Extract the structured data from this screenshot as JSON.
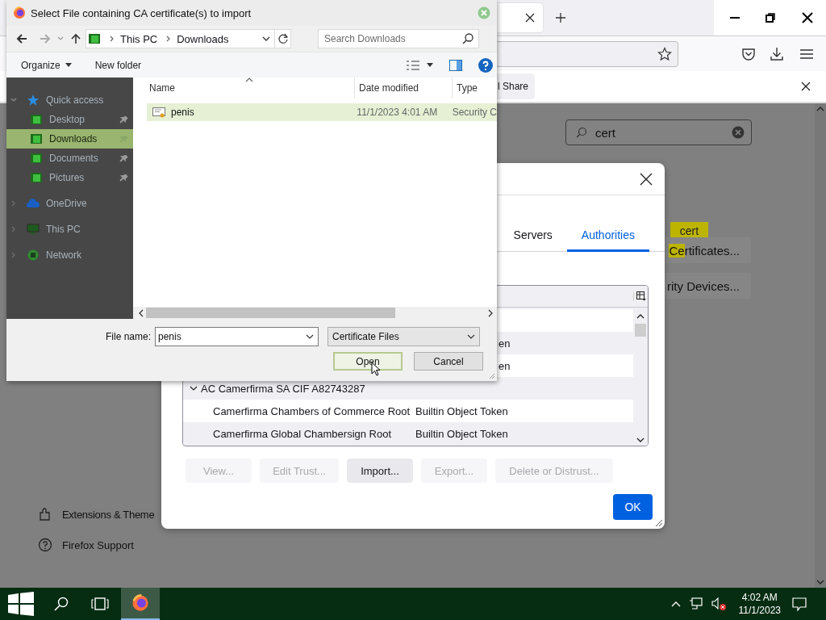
{
  "browser": {
    "notification": {
      "button": "l Share"
    },
    "search": {
      "value": "cert"
    },
    "tooltip": "cert",
    "setting_buttons": [
      {
        "highlighted": "Ce",
        "label": "rtificates..."
      },
      {
        "label": "rity Devices..."
      }
    ],
    "sidebar": [
      {
        "kind": "puzzle",
        "label": "Extensions & Theme"
      },
      {
        "kind": "help",
        "label": "Firefox Support"
      }
    ]
  },
  "cert_dialog": {
    "tabs": [
      {
        "label": "Servers",
        "selected": false
      },
      {
        "label": "Authorities",
        "selected": true
      }
    ],
    "rows": [
      {
        "kind": "blank"
      },
      {
        "kind": "tail",
        "column_2": "en"
      },
      {
        "kind": "tail",
        "column_2": "en"
      },
      {
        "kind": "group",
        "name": "AC Camerfirma SA CIF A82743287",
        "expanded": true,
        "children": [
          {
            "name": "Camerfirma Chambers of Commerce Root",
            "device": "Builtin Object Token"
          },
          {
            "name": "Camerfirma Global Chambersign Root",
            "device": "Builtin Object Token"
          }
        ]
      }
    ],
    "buttons": [
      {
        "label": "View...",
        "disabled": true
      },
      {
        "label": "Edit Trust...",
        "disabled": true
      },
      {
        "label": "Import...",
        "disabled": false
      },
      {
        "label": "Export...",
        "disabled": true
      },
      {
        "label": "Delete or Distrust...",
        "disabled": true
      }
    ],
    "ok": "OK"
  },
  "file_dialog": {
    "title": "Select File containing CA certificate(s) to import",
    "path": [
      "This PC",
      "Downloads"
    ],
    "search_placeholder": "Search Downloads",
    "organize": "Organize",
    "new_folder": "New folder",
    "nav": [
      {
        "label": "Quick access",
        "kind": "star",
        "expanded": true,
        "selected": false,
        "children": [
          {
            "label": "Desktop",
            "pinned": true,
            "selected": false
          },
          {
            "label": "Downloads",
            "pinned": true,
            "selected": true
          },
          {
            "label": "Documents",
            "pinned": true,
            "selected": false
          },
          {
            "label": "Pictures",
            "pinned": true,
            "selected": false
          }
        ]
      },
      {
        "label": "OneDrive",
        "kind": "cloud",
        "expanded": false,
        "selected": false
      },
      {
        "label": "This PC",
        "kind": "pc",
        "expanded": false,
        "selected": false
      },
      {
        "label": "Network",
        "kind": "network",
        "expanded": false,
        "selected": false
      }
    ],
    "columns": [
      "Name",
      "Date modified",
      "Type"
    ],
    "files": [
      {
        "name": "penis",
        "date": "11/1/2023 4:01 AM",
        "type": "Security C",
        "selected": true
      }
    ],
    "file_name_label": "File name:",
    "file_name": "penis",
    "filter": "Certificate Files",
    "buttons": [
      {
        "label": "Open",
        "focused": true
      },
      {
        "label": "Cancel",
        "focused": false
      }
    ]
  },
  "taskbar": {
    "apps": [
      {
        "kind": "firefox",
        "active": true
      }
    ],
    "time": "4:02 AM",
    "date": "11/1/2023"
  }
}
